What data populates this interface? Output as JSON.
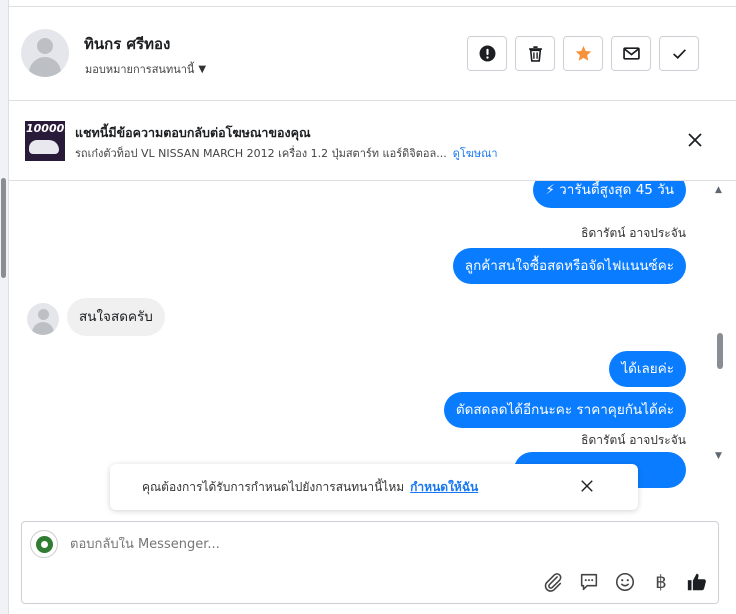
{
  "header": {
    "contact_name": "ทินกร ศรีทอง",
    "assign_label": "มอบหมายการสนทนานี้",
    "actions": [
      {
        "name": "mark-spam-button",
        "icon": "exclamation-icon"
      },
      {
        "name": "delete-button",
        "icon": "trash-icon"
      },
      {
        "name": "star-button",
        "icon": "star-icon"
      },
      {
        "name": "mark-unread-button",
        "icon": "envelope-icon"
      },
      {
        "name": "mark-done-button",
        "icon": "check-icon"
      }
    ]
  },
  "ad_banner": {
    "thumb_text": "10000.",
    "title": "แชทนี้มีข้อความตอบกลับต่อโฆษณาของคุณ",
    "description": "รถเก๋งตัวท็อป VL NISSAN MARCH 2012 เครื่อง 1.2 ปุ่มสตาร์ท แอร์ดิจิตอล...",
    "view_ad_link": "ดูโฆษณา"
  },
  "messages": {
    "m1": "⚡ วารันตี้สูงสุด 45 วัน",
    "sender1": "ธิดารัตน์ อาจประจัน",
    "m2": "ลูกค้าสนใจซื้อสดหรือจัดไฟแนนซ์คะ",
    "m3": "สนใจสดครับ",
    "m4": "ได้เลยค่ะ",
    "m5": "ตัดสดลดได้อีกนะคะ ราคาคุยกันได้ค่ะ",
    "sender2": "ธิดารัตน์ อาจประจัน"
  },
  "toast": {
    "text": "คุณต้องการได้รับการกำหนดไปยังการสนทนานี้ไหม",
    "link": "กำหนดให้ฉัน"
  },
  "composer": {
    "placeholder": "ตอบกลับใน Messenger...",
    "tools": [
      "paperclip-icon",
      "saved-replies-icon",
      "emoji-icon",
      "baht-icon",
      "thumbs-up-icon"
    ],
    "baht_symbol": "฿"
  },
  "colors": {
    "accent": "#0a7cff",
    "star": "#f7923a",
    "link": "#1877f2"
  }
}
